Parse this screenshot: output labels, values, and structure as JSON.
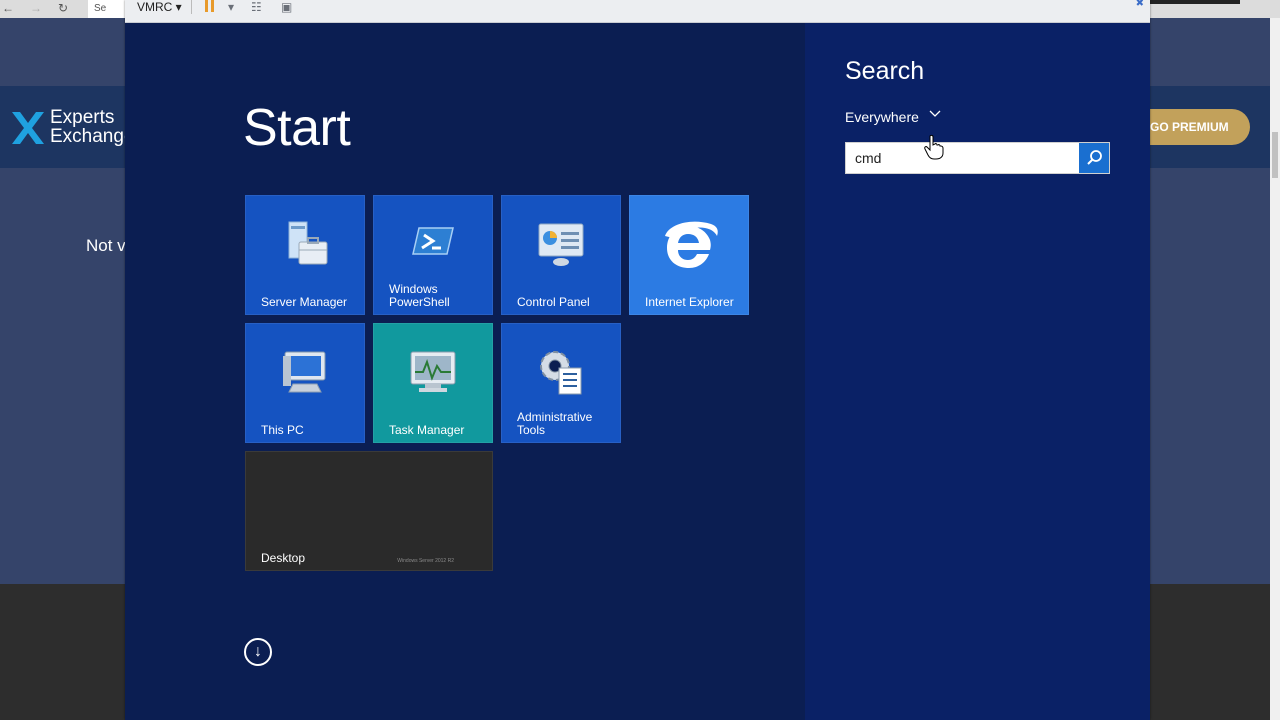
{
  "background_page": {
    "browser_tab_fragment": "Se",
    "logo_line1": "Experts",
    "logo_line2": "Exchange",
    "premium_button": "GO PREMIUM",
    "body_fragment": "Not v"
  },
  "vmrc": {
    "title_label": "VMRC ▾"
  },
  "start": {
    "title": "Start",
    "tiles": [
      {
        "label": "Server Manager",
        "icon": "server-manager-icon"
      },
      {
        "label": "Windows PowerShell",
        "icon": "powershell-icon"
      },
      {
        "label": "Control Panel",
        "icon": "control-panel-icon"
      },
      {
        "label": "Internet Explorer",
        "icon": "internet-explorer-icon"
      },
      {
        "label": "This PC",
        "icon": "computer-icon"
      },
      {
        "label": "Task Manager",
        "icon": "task-manager-icon"
      },
      {
        "label": "Administrative Tools",
        "icon": "admin-tools-icon"
      },
      {
        "label": "Desktop",
        "watermark": "Windows Server 2012 R2"
      }
    ]
  },
  "search": {
    "title": "Search",
    "scope": "Everywhere",
    "query": "cmd"
  },
  "colors": {
    "start_bg": "#0b1e52",
    "search_panel_bg": "#0a2166",
    "tile_blue": "#1553c1",
    "tile_ie": "#2c7be3",
    "tile_teal": "#11999e",
    "tile_desktop": "#2a2a2a",
    "premium_gold": "#c2a15b"
  }
}
